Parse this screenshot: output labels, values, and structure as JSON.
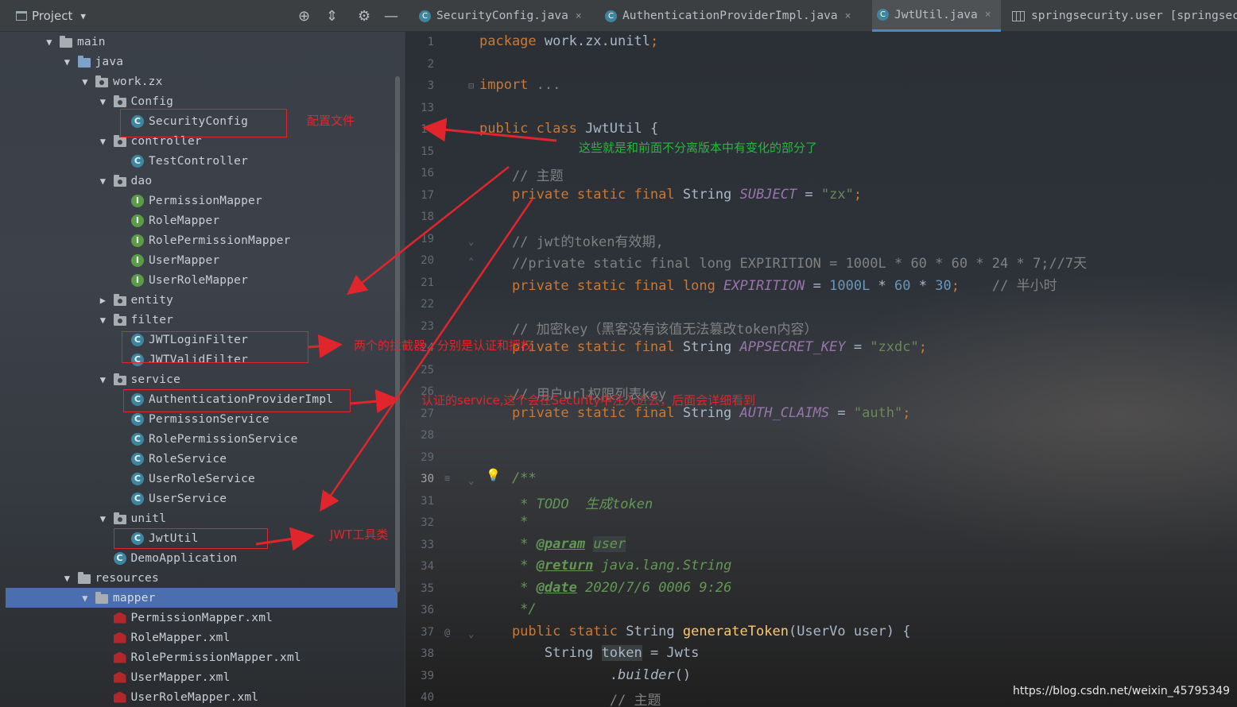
{
  "project_panel": {
    "title": "Project",
    "toolbar_icons": [
      "locate-icon",
      "collapse-icon",
      "gear-icon",
      "minimize-icon"
    ],
    "tree": [
      {
        "label": "main",
        "kind": "folder",
        "expanded": true
      },
      {
        "label": "java",
        "kind": "src-folder",
        "expanded": true
      },
      {
        "label": "work.zx",
        "kind": "package",
        "expanded": true
      },
      {
        "label": "Config",
        "kind": "package",
        "expanded": true
      },
      {
        "label": "SecurityConfig",
        "kind": "class"
      },
      {
        "label": "controller",
        "kind": "package",
        "expanded": true
      },
      {
        "label": "TestController",
        "kind": "class"
      },
      {
        "label": "dao",
        "kind": "package",
        "expanded": true
      },
      {
        "label": "PermissionMapper",
        "kind": "interface"
      },
      {
        "label": "RoleMapper",
        "kind": "interface"
      },
      {
        "label": "RolePermissionMapper",
        "kind": "interface"
      },
      {
        "label": "UserMapper",
        "kind": "interface"
      },
      {
        "label": "UserRoleMapper",
        "kind": "interface"
      },
      {
        "label": "entity",
        "kind": "package",
        "expanded": false
      },
      {
        "label": "filter",
        "kind": "package",
        "expanded": true
      },
      {
        "label": "JWTLoginFilter",
        "kind": "class"
      },
      {
        "label": "JWTValidFilter",
        "kind": "class"
      },
      {
        "label": "service",
        "kind": "package",
        "expanded": true
      },
      {
        "label": "AuthenticationProviderImpl",
        "kind": "class"
      },
      {
        "label": "PermissionService",
        "kind": "class"
      },
      {
        "label": "RolePermissionService",
        "kind": "class"
      },
      {
        "label": "RoleService",
        "kind": "class"
      },
      {
        "label": "UserRoleService",
        "kind": "class"
      },
      {
        "label": "UserService",
        "kind": "class"
      },
      {
        "label": "unitl",
        "kind": "package",
        "expanded": true
      },
      {
        "label": "JwtUtil",
        "kind": "class"
      },
      {
        "label": "DemoApplication",
        "kind": "app"
      },
      {
        "label": "resources",
        "kind": "res-folder",
        "expanded": true
      },
      {
        "label": "mapper",
        "kind": "folder",
        "expanded": true,
        "selected": true
      },
      {
        "label": "PermissionMapper.xml",
        "kind": "xml"
      },
      {
        "label": "RoleMapper.xml",
        "kind": "xml"
      },
      {
        "label": "RolePermissionMapper.xml",
        "kind": "xml"
      },
      {
        "label": "UserMapper.xml",
        "kind": "xml"
      },
      {
        "label": "UserRoleMapper.xml",
        "kind": "xml"
      }
    ]
  },
  "tabs": [
    {
      "label": "SecurityConfig.java",
      "icon": "class-icon",
      "active": false
    },
    {
      "label": "AuthenticationProviderImpl.java",
      "icon": "class-icon",
      "active": false
    },
    {
      "label": "JwtUtil.java",
      "icon": "class-icon",
      "active": true
    },
    {
      "label": "springsecurity.user [springsec",
      "icon": "table-icon",
      "active": false
    }
  ],
  "editor": {
    "current_line": "30",
    "lines": [
      {
        "n": "1",
        "code": [
          [
            "kw",
            "package "
          ],
          [
            "",
            "work.zx.unitl"
          ],
          [
            "kw",
            ";"
          ]
        ]
      },
      {
        "n": "2",
        "code": []
      },
      {
        "n": "3",
        "code": [
          [
            "kw",
            "import "
          ],
          [
            "cmt",
            "..."
          ]
        ]
      },
      {
        "n": "13",
        "code": []
      },
      {
        "n": "14",
        "code": [
          [
            "kw",
            "public class "
          ],
          [
            "",
            "JwtUtil {"
          ]
        ]
      },
      {
        "n": "15",
        "code": []
      },
      {
        "n": "16",
        "code": [
          [
            "cmt",
            "    // 主题"
          ]
        ]
      },
      {
        "n": "17",
        "code": [
          [
            "kw",
            "    private static final "
          ],
          [
            "",
            "String "
          ],
          [
            "field",
            "SUBJECT"
          ],
          [
            "",
            " = "
          ],
          [
            "str",
            "\"zx\""
          ],
          [
            "kw",
            ";"
          ]
        ]
      },
      {
        "n": "18",
        "code": []
      },
      {
        "n": "19",
        "code": [
          [
            "cmt",
            "    // jwt的token有效期,"
          ]
        ]
      },
      {
        "n": "20",
        "code": [
          [
            "cmt",
            "    //private static final long EXPIRITION = 1000L * 60 * 60 * 24 * 7;//7天"
          ]
        ]
      },
      {
        "n": "21",
        "code": [
          [
            "kw",
            "    private static final long "
          ],
          [
            "field",
            "EXPIRITION"
          ],
          [
            "",
            " = "
          ],
          [
            "num",
            "1000L"
          ],
          [
            "",
            " * "
          ],
          [
            "num",
            "60"
          ],
          [
            "",
            " * "
          ],
          [
            "num",
            "30"
          ],
          [
            "kw",
            ";"
          ],
          [
            "cmt",
            "    // 半小时"
          ]
        ]
      },
      {
        "n": "22",
        "code": []
      },
      {
        "n": "23",
        "code": [
          [
            "cmt",
            "    // 加密key（黑客没有该值无法篡改token内容）"
          ]
        ]
      },
      {
        "n": "24",
        "code": [
          [
            "kw",
            "    private static final "
          ],
          [
            "",
            "String "
          ],
          [
            "field",
            "APPSECRET_KEY"
          ],
          [
            "",
            " = "
          ],
          [
            "str",
            "\"zxdc\""
          ],
          [
            "kw",
            ";"
          ]
        ]
      },
      {
        "n": "25",
        "code": []
      },
      {
        "n": "26",
        "code": [
          [
            "cmt",
            "    // 用户url权限列表key"
          ]
        ]
      },
      {
        "n": "27",
        "code": [
          [
            "kw",
            "    private static final "
          ],
          [
            "",
            "String "
          ],
          [
            "field",
            "AUTH_CLAIMS"
          ],
          [
            "",
            " = "
          ],
          [
            "str",
            "\"auth\""
          ],
          [
            "kw",
            ";"
          ]
        ]
      },
      {
        "n": "28",
        "code": []
      },
      {
        "n": "29",
        "code": []
      },
      {
        "n": "30",
        "code": [
          [
            "doc",
            "    /**"
          ]
        ]
      },
      {
        "n": "31",
        "code": [
          [
            "doc",
            "     * TODO  生成token"
          ]
        ]
      },
      {
        "n": "32",
        "code": [
          [
            "doc",
            "     *"
          ]
        ]
      },
      {
        "n": "33",
        "code": [
          [
            "doc",
            "     * "
          ],
          [
            "doctag",
            "@param"
          ],
          [
            "doc",
            " "
          ],
          [
            "hl-doc",
            "user"
          ]
        ]
      },
      {
        "n": "34",
        "code": [
          [
            "doc",
            "     * "
          ],
          [
            "doctag",
            "@return"
          ],
          [
            "doc",
            " java.lang.String"
          ]
        ]
      },
      {
        "n": "35",
        "code": [
          [
            "doc",
            "     * "
          ],
          [
            "doctag",
            "@date"
          ],
          [
            "doc",
            " 2020/7/6 0006 9:26"
          ]
        ]
      },
      {
        "n": "36",
        "code": [
          [
            "doc",
            "     */"
          ]
        ]
      },
      {
        "n": "37",
        "code": [
          [
            "kw",
            "    public static "
          ],
          [
            "",
            "String "
          ],
          [
            "fn",
            "generateToken"
          ],
          [
            "",
            "(UserVo user) {"
          ]
        ]
      },
      {
        "n": "38",
        "code": [
          [
            "",
            "        String "
          ],
          [
            "hl",
            "token"
          ],
          [
            "",
            " = Jwts"
          ]
        ]
      },
      {
        "n": "39",
        "code": [
          [
            "",
            "                ."
          ],
          [
            "italic",
            "builder"
          ],
          [
            "",
            "()"
          ]
        ]
      },
      {
        "n": "40",
        "code": [
          [
            "cmt",
            "                // 主题"
          ]
        ]
      }
    ]
  },
  "annotations": {
    "config_note": "配置文件",
    "changed_note": "这些就是和前面不分离版本中有变化的部分了",
    "filters_note": "两个的拦截器，分别是认证和授权",
    "service_note": "认证的service,这个会在Security中注入进去，后面会详细看到",
    "jwt_note": "JWT工具类",
    "color_red": "#e0262c",
    "color_green": "#28b63c"
  },
  "watermark": "https://blog.csdn.net/weixin_45795349"
}
